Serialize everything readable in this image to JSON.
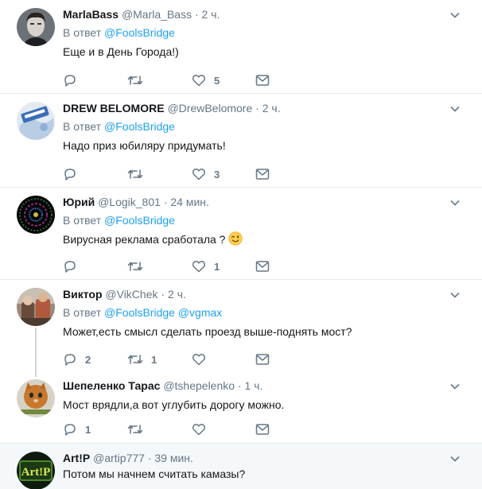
{
  "reply_prefix": "В ответ",
  "separator": "·",
  "tweets": [
    {
      "fullname": "MarlaBass",
      "username": "@Marla_Bass",
      "time": "2 ч.",
      "reply_to": [
        "@FoolsBridge"
      ],
      "text": "Еще и в День Города!)",
      "replies": "",
      "retweets": "",
      "likes": "5"
    },
    {
      "fullname": "DREW BELOMORE",
      "username": "@DrewBelomore",
      "time": "2 ч.",
      "reply_to": [
        "@FoolsBridge"
      ],
      "text": "Надо приз юбиляру придумать!",
      "replies": "",
      "retweets": "",
      "likes": "3"
    },
    {
      "fullname": "Юрий",
      "username": "@Logik_801",
      "time": "24 мин.",
      "reply_to": [
        "@FoolsBridge"
      ],
      "text": "Вирусная реклама сработала ?",
      "emoji": "winking-face",
      "replies": "",
      "retweets": "",
      "likes": "1"
    },
    {
      "fullname": "Виктор",
      "username": "@VikChek",
      "time": "2 ч.",
      "reply_to": [
        "@FoolsBridge",
        "@vgmax"
      ],
      "text": "Может,есть смысл сделать проезд выше-поднять мост?",
      "replies": "2",
      "retweets": "1",
      "likes": ""
    },
    {
      "fullname": "Шепеленко Тарас",
      "username": "@tshepelenko",
      "time": "1 ч.",
      "text": "Мост врядли,а вот углубить дорогу можно.",
      "replies": "1",
      "retweets": "",
      "likes": ""
    },
    {
      "fullname": "Art!P",
      "username": "@artip777",
      "time": "39 мин.",
      "text": "Потом мы начнем считать камазы?",
      "avatar_text": "Art!P"
    }
  ],
  "icons": {
    "reply": "reply-icon",
    "retweet": "retweet-icon",
    "like": "heart-icon",
    "dm": "envelope-icon",
    "more": "chevron-down-icon"
  },
  "colors": {
    "link": "#1da1f2",
    "secondary_text": "#657786",
    "border": "#e6ecf0",
    "highlight_bg": "#f5f8fa",
    "thread_line": "#ccd6dd"
  }
}
